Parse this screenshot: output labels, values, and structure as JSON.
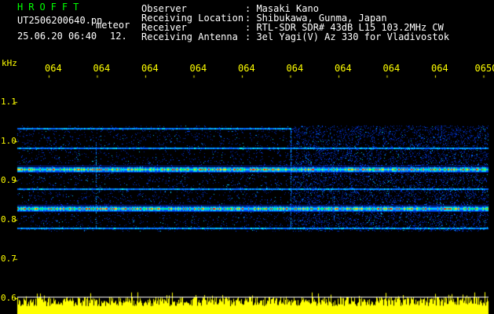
{
  "header": {
    "logo": "HROFFT",
    "filename": "UT2506200640.pn",
    "mode": "meteor",
    "date_time": "25.06.20 06:40",
    "number": "12.",
    "info": [
      {
        "label": "Observer",
        "value": ": Masaki Kano"
      },
      {
        "label": "Receiving Location",
        "value": ": Shibukawa, Gunma, Japan"
      },
      {
        "label": "Receiver",
        "value": ": RTL-SDR SDR# 43dB L15 103.2MHz CW"
      },
      {
        "label": "Receiving Antenna",
        "value": ": 3el Yagi(V) Az 330 for Vladivostok"
      }
    ]
  },
  "spectrogram": {
    "y_unit": "kHz",
    "y_ticks": [
      "1.1",
      "1.0",
      "0.9",
      "0.8",
      "0.7",
      "0.6"
    ],
    "y_range": [
      0.6,
      1.15
    ],
    "x_ticks": [
      "064",
      "064",
      "064",
      "064",
      "064",
      "064",
      "064",
      "064",
      "064",
      "0650"
    ],
    "signal_lines_khz": [
      1.035,
      0.985,
      0.93,
      0.88,
      0.83,
      0.78
    ],
    "colors": {
      "background": "#000000",
      "axis": "#ffff00",
      "noise": "#0033ff",
      "hot": "#ff2200",
      "baseline": "#ffff00"
    }
  }
}
